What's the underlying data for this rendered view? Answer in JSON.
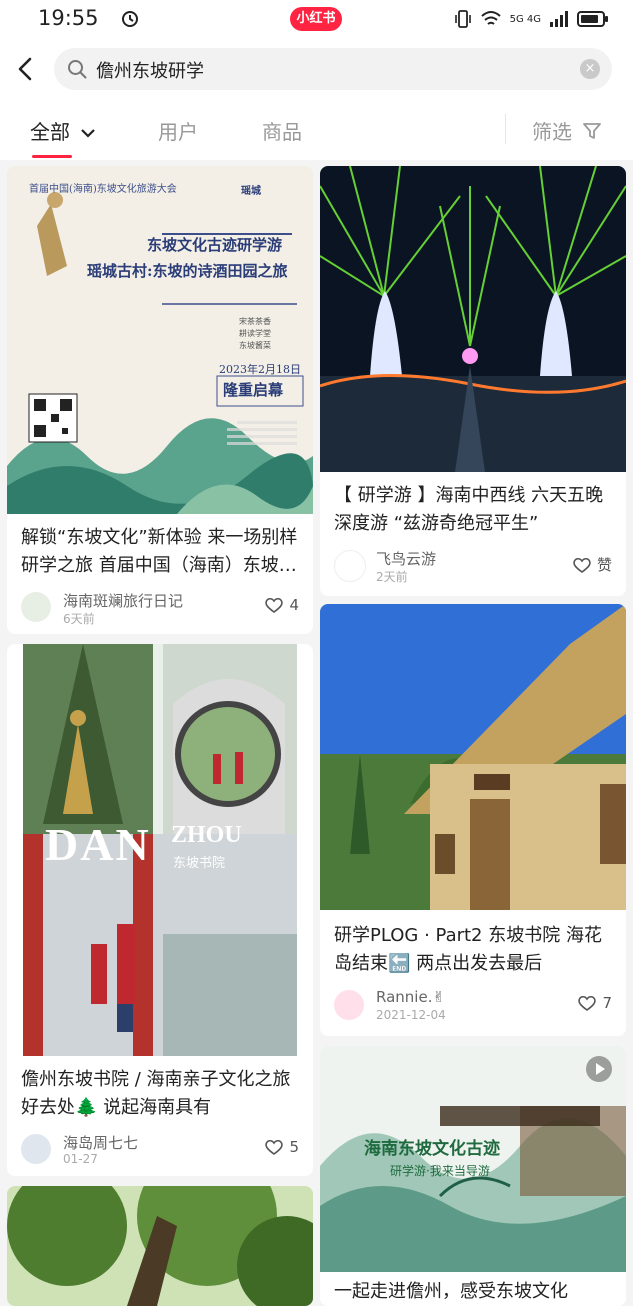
{
  "status": {
    "time": "19:55",
    "badge": "小红书",
    "signal": "5G 4G"
  },
  "search": {
    "query": "儋州东坡研学",
    "clear": "×"
  },
  "tabs": {
    "all": "全部",
    "users": "用户",
    "goods": "商品",
    "filter": "筛选"
  },
  "colors": {
    "accent": "#ff2442"
  },
  "cards": [
    {
      "title": "解锁“东坡文化”新体验 来一场别样研学之旅 首届中国（海南）东坡文化旅游大会",
      "author": "海南斑斓旅行日记",
      "date": "6天前",
      "likes": "4",
      "poster": {
        "top": "首届中国(海南)东坡文化旅游大会",
        "head1": "东坡文化古迹研学游",
        "head2": "瑶城古村:东坡的诗酒田园之旅",
        "brand": "瑶城",
        "tags": [
          "宋茶茶香",
          "耕读学堂",
          "东坡酱菜"
        ],
        "date": "2023年2月18日",
        "launch": "隆重启幕"
      }
    },
    {
      "title": "【 研学游 】海南中西线 六天五晚深度游 “兹游奇绝冠平生”",
      "author": "飞鸟云游",
      "date": "2天前",
      "likes": "赞"
    },
    {
      "title": "儋州东坡书院 / 海南亲子文化之旅好去处🌲 说起海南具有",
      "author": "海岛周七七",
      "date": "01-27",
      "likes": "5",
      "overlay": {
        "big": "DAN",
        "zhou": "ZHOU",
        "sub": "东坡书院"
      }
    },
    {
      "title": "研学PLOG · Part2 东坡书院 海花岛结束🔚 两点出发去最后",
      "author": "Rannie.✌",
      "date": "2021-12-04",
      "likes": "7"
    },
    {
      "title": "一起走进儋州，感受东坡文化",
      "overlay": {
        "line1": "海南东坡文化古迹",
        "line2": "研学游·我来当导游"
      }
    }
  ],
  "icons": [
    "back-icon",
    "search-icon",
    "clear-icon",
    "chevron-down-icon",
    "filter-icon",
    "heart-icon",
    "play-icon",
    "alarm-icon"
  ]
}
